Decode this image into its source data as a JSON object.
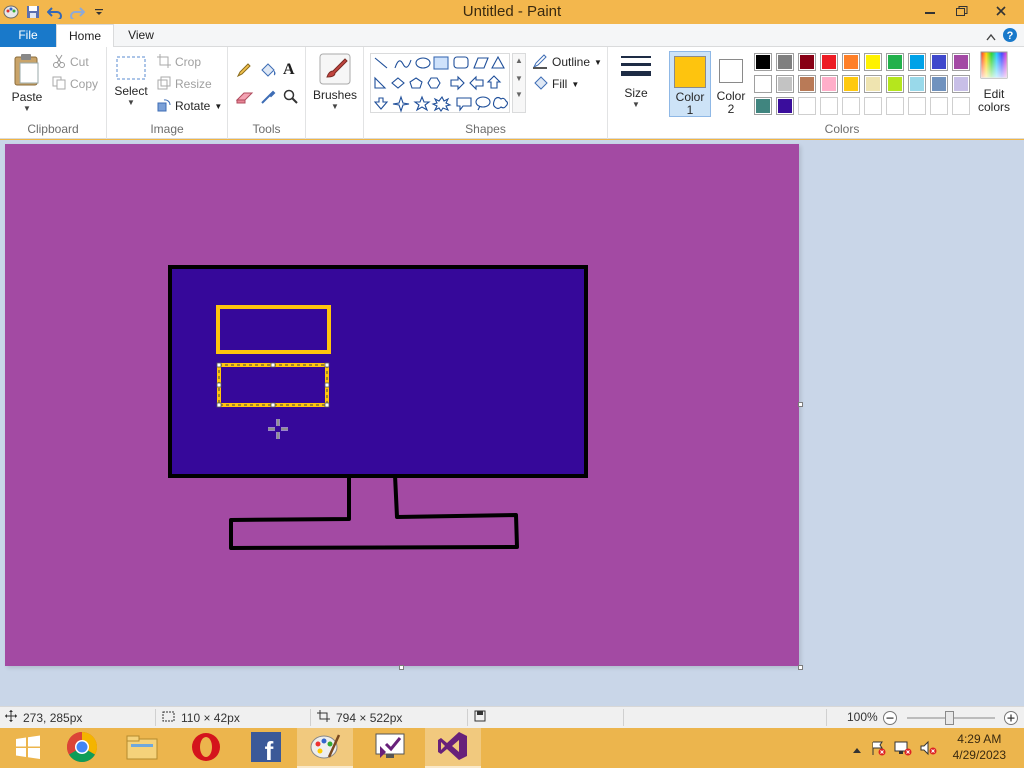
{
  "window": {
    "title": "Untitled - Paint"
  },
  "tabs": [
    {
      "label": "File"
    },
    {
      "label": "Home"
    },
    {
      "label": "View"
    }
  ],
  "ribbon": {
    "clipboard": {
      "label": "Clipboard",
      "paste": "Paste",
      "cut": "Cut",
      "copy": "Copy"
    },
    "image": {
      "label": "Image",
      "select": "Select",
      "crop": "Crop",
      "resize": "Resize",
      "rotate": "Rotate"
    },
    "tools": {
      "label": "Tools"
    },
    "brushes": {
      "label": "Brushes"
    },
    "shapes": {
      "label": "Shapes",
      "outline": "Outline",
      "fill": "Fill"
    },
    "size": {
      "label": "Size"
    },
    "color1": {
      "line1": "Color",
      "line2": "1",
      "value": "#fec40e"
    },
    "color2": {
      "line1": "Color",
      "line2": "2",
      "value": "#ffffff"
    },
    "colors": {
      "label": "Colors",
      "edit_line1": "Edit",
      "edit_line2": "colors",
      "palette": [
        [
          "#000000",
          "#7f7f7f",
          "#880015",
          "#ed1c24",
          "#ff7f27",
          "#fff200",
          "#22b14c",
          "#00a2e8",
          "#3f48cc",
          "#a349a4"
        ],
        [
          "#ffffff",
          "#c3c3c3",
          "#b97a57",
          "#ffaec9",
          "#ffc90e",
          "#efe4b0",
          "#b5e61d",
          "#99d9ea",
          "#7092be",
          "#c8bfe7"
        ],
        [
          "#40857f",
          "#3a0d9c",
          "#ffffff",
          "#ffffff",
          "#ffffff",
          "#ffffff",
          "#ffffff",
          "#ffffff",
          "#ffffff",
          "#ffffff"
        ]
      ]
    }
  },
  "canvas": {
    "background": "#a34aa3",
    "monitor_screen": "#36089a",
    "outline": "#000000",
    "rect_color": "#fec40e"
  },
  "status": {
    "cursor_pos": "273, 285px",
    "selection_size": "110 × 42px",
    "image_size": "794 × 522px",
    "zoom": "100%"
  },
  "taskbar": {
    "time": "4:29 AM",
    "date": "4/29/2023"
  }
}
